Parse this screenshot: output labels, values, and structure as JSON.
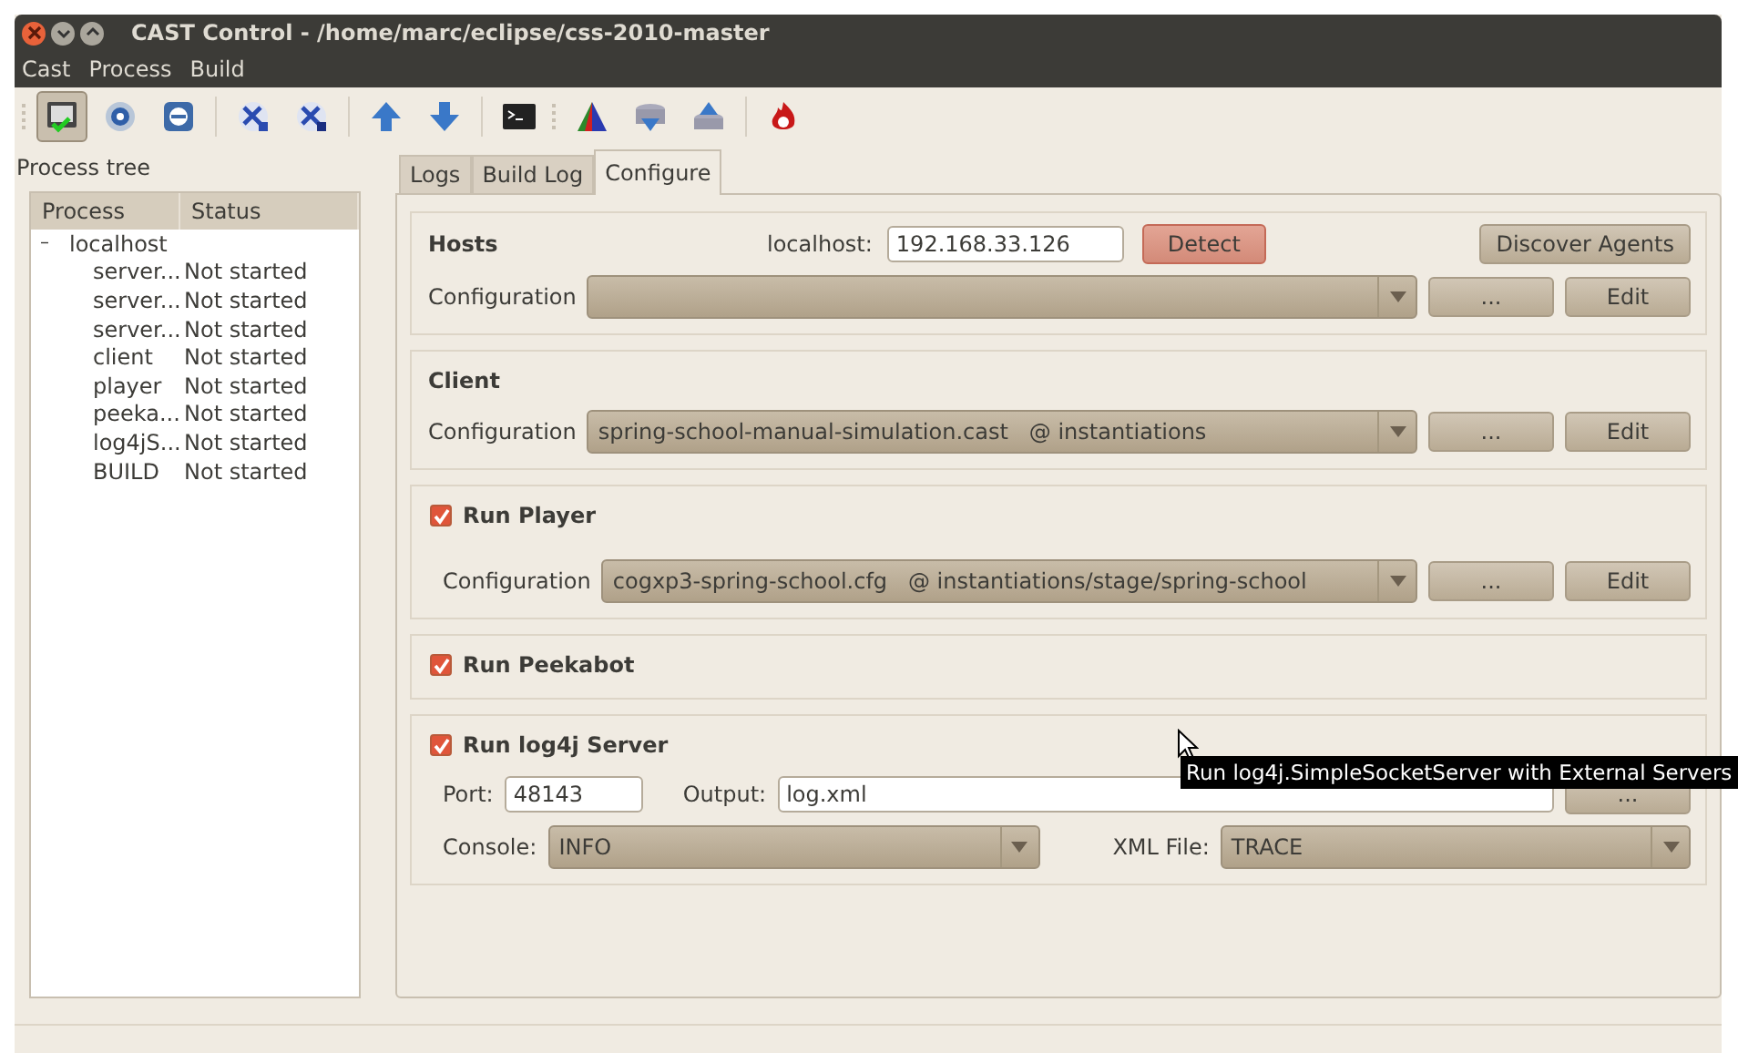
{
  "window": {
    "title": "CAST Control - /home/marc/eclipse/css-2010-master"
  },
  "menu": [
    "Cast",
    "Process",
    "Build"
  ],
  "toolbar": [
    {
      "kind": "grip"
    },
    {
      "kind": "icon",
      "pressed": true
    },
    {
      "kind": "icon",
      "pressed": false
    },
    {
      "kind": "icon",
      "pressed": false
    },
    {
      "kind": "separator"
    },
    {
      "kind": "icon",
      "pressed": false
    },
    {
      "kind": "icon",
      "pressed": false
    },
    {
      "kind": "separator"
    },
    {
      "kind": "icon",
      "pressed": false
    },
    {
      "kind": "icon",
      "pressed": false
    },
    {
      "kind": "separator"
    },
    {
      "kind": "icon",
      "pressed": false
    },
    {
      "kind": "grip"
    },
    {
      "kind": "icon",
      "pressed": false
    },
    {
      "kind": "icon",
      "pressed": false
    },
    {
      "kind": "icon",
      "pressed": false
    },
    {
      "kind": "separator"
    },
    {
      "kind": "icon",
      "pressed": false
    }
  ],
  "process_tree": {
    "label": "Process tree",
    "columns": [
      "Process",
      "Status"
    ],
    "root": {
      "name": "localhost",
      "expanded": true,
      "expander": "–",
      "children": [
        {
          "name": "server...",
          "status": "Not started"
        },
        {
          "name": "server...",
          "status": "Not started"
        },
        {
          "name": "server...",
          "status": "Not started"
        },
        {
          "name": "client",
          "status": "Not started"
        },
        {
          "name": "player",
          "status": "Not started"
        },
        {
          "name": "peeka...",
          "status": "Not started"
        },
        {
          "name": "log4jS...",
          "status": "Not started"
        },
        {
          "name": "BUILD",
          "status": "Not started"
        }
      ]
    }
  },
  "tabs": [
    {
      "label": "Logs",
      "selected": false
    },
    {
      "label": "Build Log",
      "selected": false
    },
    {
      "label": "Configure",
      "selected": true
    }
  ],
  "hosts": {
    "title": "Hosts",
    "host_label": "localhost:",
    "host_value": "192.168.33.126",
    "detect": "Detect",
    "discover": "Discover Agents",
    "config_label": "Configuration",
    "browse": "...",
    "edit": "Edit"
  },
  "client": {
    "title": "Client",
    "config_label": "Configuration",
    "config_value": "spring-school-manual-simulation.cast   @ instantiations",
    "browse": "...",
    "edit": "Edit"
  },
  "player": {
    "title": "Run Player",
    "checked": true,
    "config_label": "Configuration",
    "config_value": "cogxp3-spring-school.cfg   @ instantiations/stage/spring-school",
    "browse": "...",
    "edit": "Edit"
  },
  "peekabot": {
    "title": "Run Peekabot",
    "checked": true
  },
  "log4j": {
    "title": "Run log4j Server",
    "checked": true,
    "port_label": "Port:",
    "port_value": "48143",
    "output_label": "Output:",
    "output_value": "log.xml",
    "browse": "...",
    "console_label": "Console:",
    "console_value": "INFO",
    "xml_label": "XML File:",
    "xml_value": "TRACE"
  },
  "tooltip": "Run log4j.SimpleSocketServer with External Servers"
}
